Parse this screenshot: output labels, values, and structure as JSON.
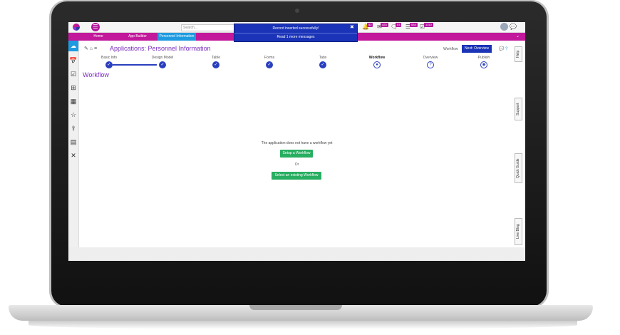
{
  "topbar": {
    "search_placeholder": "Search...",
    "badges": [
      "52",
      "423",
      "53",
      "534",
      "1310"
    ]
  },
  "nav": {
    "tabs": [
      "Home",
      "App Builder",
      "Personnel Information"
    ]
  },
  "notification": {
    "message": "Record inserted successfully!",
    "close": "✖",
    "view_all": "Read 1 more messages"
  },
  "header": {
    "title": "Applications: Personnel Information",
    "workflow_label": "Workflow",
    "next_button": "Next: Overview",
    "help_text": "?"
  },
  "stepper": {
    "steps": [
      {
        "label": "Basic Info",
        "state": "done"
      },
      {
        "label": "Design Model",
        "state": "done"
      },
      {
        "label": "Table",
        "state": "done"
      },
      {
        "label": "Forms",
        "state": "done"
      },
      {
        "label": "Tabs",
        "state": "done"
      },
      {
        "label": "Workflow",
        "state": "current"
      },
      {
        "label": "Overview",
        "state": "pending"
      },
      {
        "label": "Publish",
        "state": "pending"
      }
    ]
  },
  "main": {
    "section_title": "Workflow",
    "empty_message": "The application does not have a workflow yet",
    "setup_button": "Setup a Workflow",
    "or_text": "Or",
    "select_button": "Select an existing Workflow"
  },
  "right_tabs": [
    "Help",
    "Support",
    "Quick Guide",
    "Live Blog"
  ],
  "colors": {
    "brand": "#c2189b",
    "primary": "#1a33b7",
    "success": "#27ae60",
    "accent_title": "#7b2cbf"
  }
}
